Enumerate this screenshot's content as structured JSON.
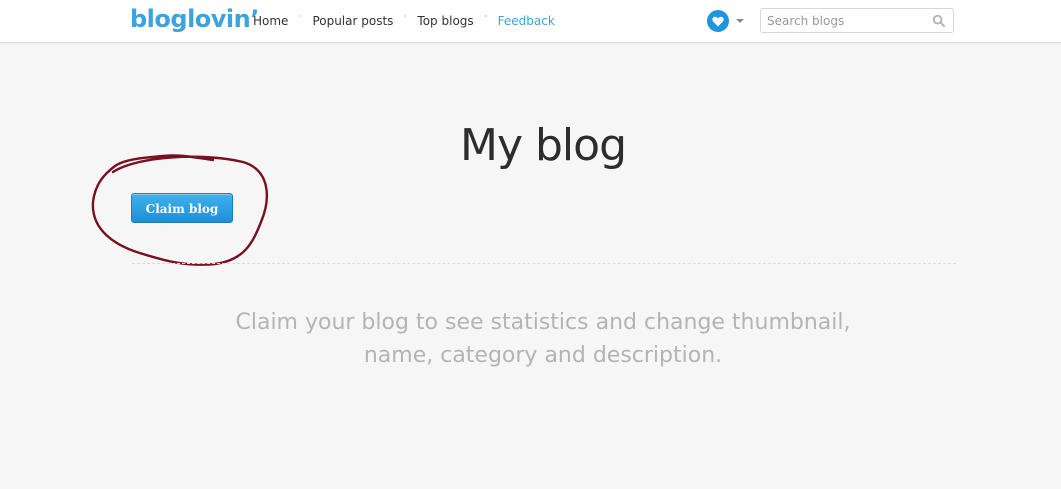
{
  "header": {
    "logo": {
      "text": "bloglovin’",
      "color": "#3ca3de"
    },
    "nav": [
      {
        "label": "Home",
        "color": "#333333"
      },
      {
        "label": "Popular posts",
        "color": "#333333"
      },
      {
        "label": "Top blogs",
        "color": "#333333"
      },
      {
        "label": "Feedback",
        "color": "#3ca3de"
      }
    ],
    "favorites_icon": "heart-icon",
    "heart_color": "#1e95dd",
    "search": {
      "placeholder": "Search blogs",
      "icon": "magnifier-icon"
    }
  },
  "main": {
    "title": "My blog",
    "claim_button_label": "Claim blog",
    "description_lines": [
      "Claim your blog to see statistics and change thumbnail,",
      "name, category and description."
    ]
  },
  "colors": {
    "accent": "#1e95dd",
    "annotation": "#7a0f20",
    "background": "#f6f6f6"
  }
}
